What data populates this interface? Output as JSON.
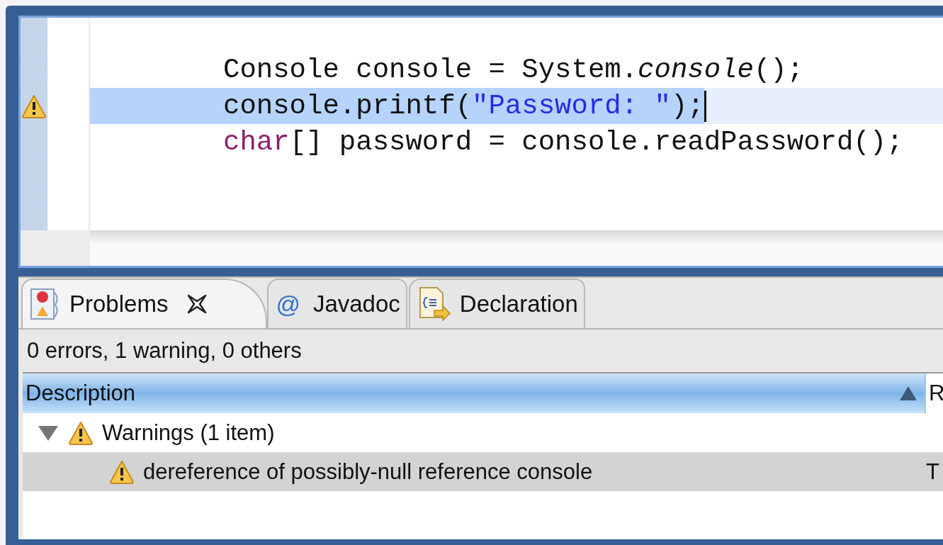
{
  "editor": {
    "lines": [
      {
        "warning": false,
        "selected": false,
        "tokens": [
          {
            "kind": "plain",
            "text": "Console console = System."
          },
          {
            "kind": "italic",
            "text": "console"
          },
          {
            "kind": "plain",
            "text": "();"
          }
        ]
      },
      {
        "warning": true,
        "selected": true,
        "tokens": [
          {
            "kind": "plain",
            "text": "console.printf("
          },
          {
            "kind": "string",
            "text": "\"Password: \""
          },
          {
            "kind": "plain",
            "text": ");"
          }
        ]
      },
      {
        "warning": false,
        "selected": false,
        "tokens": [
          {
            "kind": "keyword",
            "text": "char"
          },
          {
            "kind": "plain",
            "text": "[] password = console.readPassword();"
          }
        ]
      }
    ]
  },
  "panel": {
    "tabs": [
      {
        "kind": "problems",
        "label": "Problems",
        "selected": true,
        "closable": true
      },
      {
        "kind": "at",
        "glyph": "@",
        "label": "Javadoc",
        "selected": false,
        "closable": false
      },
      {
        "kind": "declaration",
        "label": "Declaration",
        "selected": false,
        "closable": false
      }
    ],
    "summary": "0 errors, 1 warning, 0 others",
    "columns": [
      {
        "label": "Description",
        "sorted": true
      },
      {
        "label": "R",
        "sorted": false
      }
    ],
    "rows": [
      {
        "label": "Warnings (1 item)",
        "expanded": true,
        "selected": false,
        "children": [
          {
            "label": "dereference of possibly-null reference console",
            "column_2": "T",
            "selected": true
          }
        ]
      }
    ]
  }
}
